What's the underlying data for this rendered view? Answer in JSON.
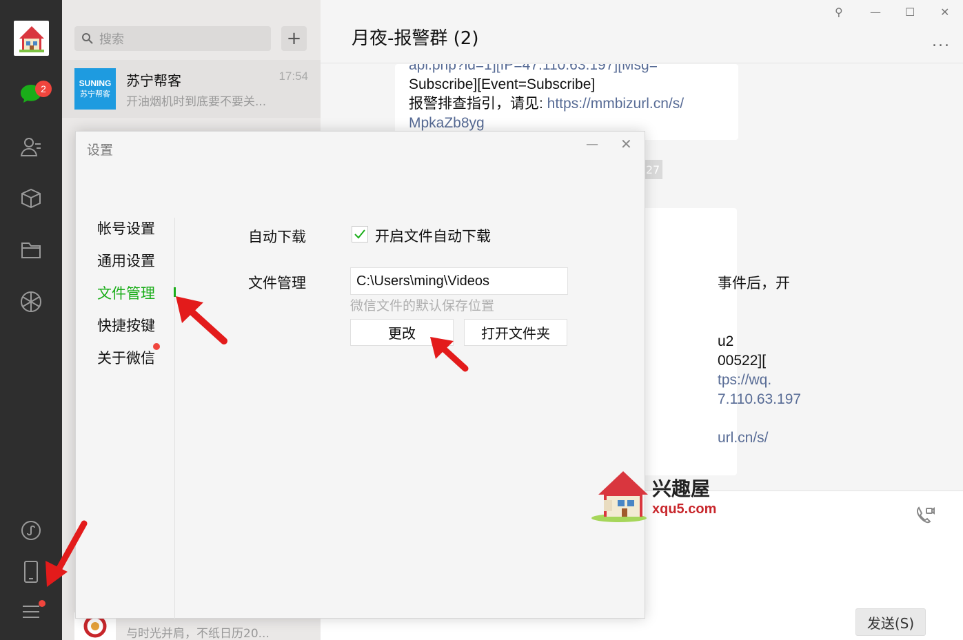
{
  "rail": {
    "unread_badge": "2",
    "icons": [
      "chat-icon",
      "contacts-icon",
      "box-icon",
      "folder-icon",
      "moments-icon",
      "miniprogram-icon",
      "phone-icon",
      "menu-icon"
    ]
  },
  "sessions": {
    "search_placeholder": "搜索",
    "add_label": "+",
    "items": [
      {
        "name": "苏宁帮客",
        "thumb_text_top": "SUNING",
        "thumb_text_bottom": "苏宁帮客",
        "time": "17:54",
        "preview": "开油烟机时到底要不要关..."
      },
      {
        "name": "",
        "time": "",
        "preview": "与时光并肩，不纸日历20..."
      }
    ]
  },
  "chat": {
    "title": "月夜-报警群 (2)",
    "more_label": "...",
    "window_controls": {
      "pin": "⚲",
      "minimize": "—",
      "maximize": "☐",
      "close": "✕"
    },
    "message1": {
      "line0": "api.php?id=1][IP=47.110.63.197][Msg=",
      "line1": "Subscribe][Event=Subscribe]",
      "line2_text": "报警排查指引，请见: ",
      "line2_link": "https://mmbizurl.cn/s/",
      "line3_link": "MpkaZb8yg"
    },
    "timestamp_fragment": "27",
    "message2": {
      "line1": "事件后，开",
      "line2": "u2",
      "line3": "00522][",
      "line4": "tps://wq.",
      "line5": "7.110.63.197",
      "line6": "url.cn/s/"
    },
    "send_label": "发送(S)"
  },
  "settings": {
    "title": "设置",
    "minimize": "—",
    "close": "✕",
    "nav": [
      {
        "label": "帐号设置",
        "active": false
      },
      {
        "label": "通用设置",
        "active": false
      },
      {
        "label": "文件管理",
        "active": true
      },
      {
        "label": "快捷按键",
        "active": false
      },
      {
        "label": "关于微信",
        "active": false
      }
    ],
    "auto_download_label": "自动下载",
    "auto_download_checked": true,
    "auto_download_option": "开启文件自动下载",
    "file_mgmt_label": "文件管理",
    "path": "C:\\Users\\ming\\Videos",
    "path_hint": "微信文件的默认保存位置",
    "change_button": "更改",
    "open_folder_button": "打开文件夹"
  },
  "watermark": {
    "name": "兴趣屋",
    "url": "xqu5.com"
  },
  "colors": {
    "accent": "#1aad19",
    "badge": "#f0453d",
    "link": "#576b95",
    "arrow": "#e31b1b",
    "rail": "#2e2e2e"
  }
}
